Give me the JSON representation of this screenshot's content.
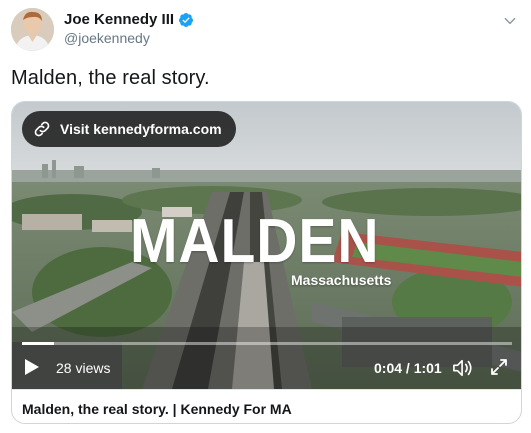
{
  "author": {
    "display_name": "Joe Kennedy III",
    "handle": "@joekennedy"
  },
  "tweet": {
    "text": "Malden, the real story."
  },
  "card": {
    "visit_label": "Visit kennedyforma.com",
    "overlay_title": "MALDEN",
    "overlay_subtitle": "Massachusetts",
    "footer_title": "Malden, the real story. | Kennedy For MA"
  },
  "player": {
    "views": "28 views",
    "time": "0:04 / 1:01",
    "progress_fraction": 0.066
  },
  "colors": {
    "verified_blue": "#1da1f2",
    "text_primary": "#14171a",
    "text_secondary": "#657786",
    "border": "#ccd6dd"
  },
  "icons": {
    "verified": "verified-badge-icon",
    "menu": "chevron-down-icon",
    "link": "link-icon",
    "play": "play-icon",
    "volume": "volume-icon",
    "fullscreen": "fullscreen-icon"
  }
}
